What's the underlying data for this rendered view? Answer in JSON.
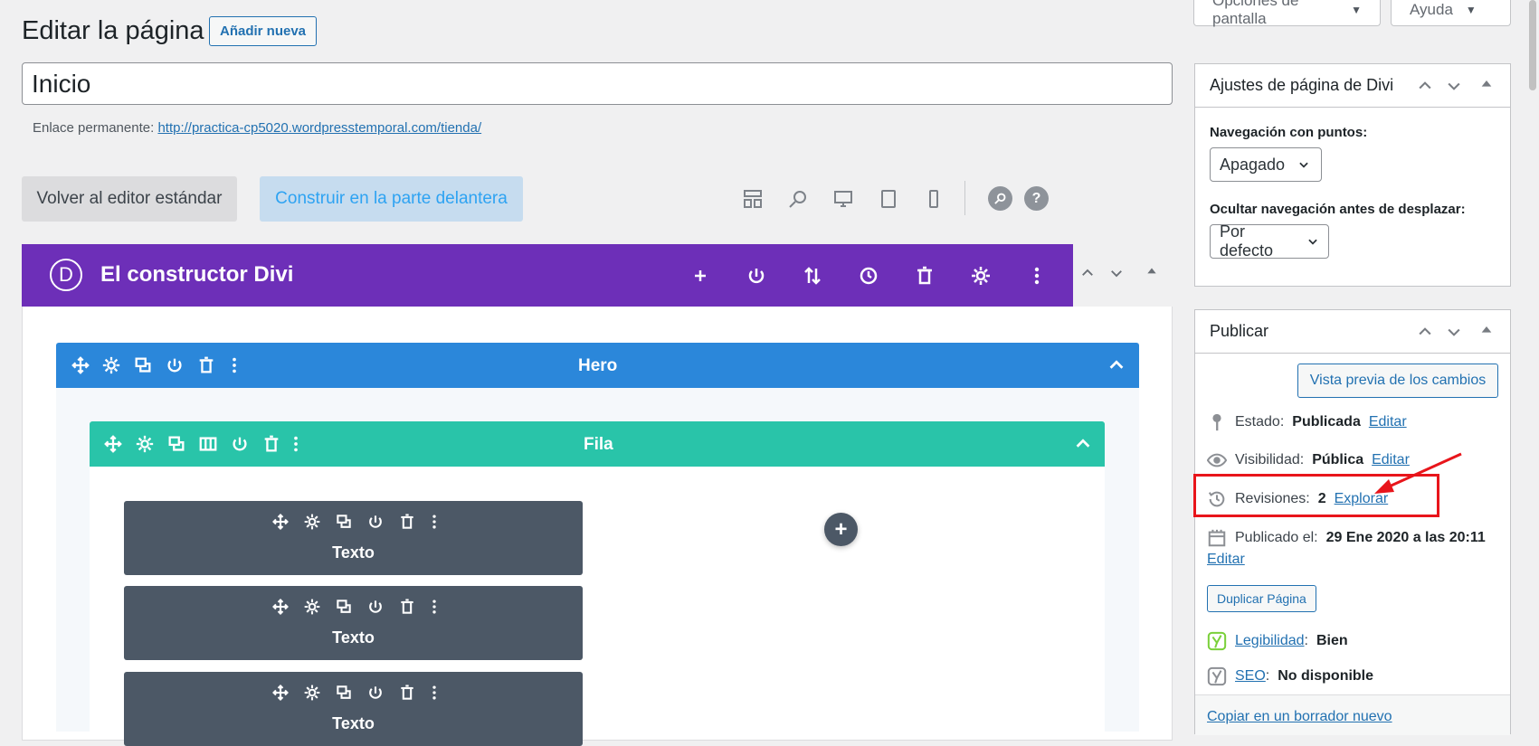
{
  "screen_options": {
    "label": "Opciones de pantalla",
    "caret": "▼"
  },
  "help": {
    "label": "Ayuda",
    "caret": "▼"
  },
  "page": {
    "title": "Editar la página",
    "add_new": "Añadir nueva",
    "post_title": "Inicio",
    "permalink_label": "Enlace permanente:",
    "permalink_url": "http://practica-cp5020.wordpresstemporal.com/tienda/"
  },
  "editor_buttons": {
    "standard": "Volver al editor estándar",
    "frontend": "Construir en la parte delantera"
  },
  "toolbar_icons": [
    "layout-icon",
    "zoom-icon",
    "desktop-icon",
    "tablet-icon",
    "phone-icon",
    "search-icon",
    "help-icon"
  ],
  "help_glyph": "?",
  "divi": {
    "logo": "D",
    "title": "El constructor Divi",
    "icons": [
      "add-icon",
      "power-icon",
      "sort-icon",
      "history-icon",
      "trash-icon",
      "settings-icon",
      "more-icon"
    ]
  },
  "section": {
    "title": "Hero"
  },
  "row": {
    "title": "Fila"
  },
  "modules": [
    {
      "title": "Texto"
    },
    {
      "title": "Texto"
    },
    {
      "title": "Texto"
    }
  ],
  "add_module_glyph": "+",
  "divi_settings": {
    "title": "Ajustes de página de Divi",
    "dot_nav_label": "Navegación con puntos:",
    "dot_nav_value": "Apagado",
    "hide_nav_label": "Ocultar navegación antes de desplazar:",
    "hide_nav_value": "Por defecto"
  },
  "publish": {
    "title": "Publicar",
    "preview": "Vista previa de los cambios",
    "status_label": "Estado:",
    "status_value": "Publicada",
    "visibility_label": "Visibilidad:",
    "visibility_value": "Pública",
    "edit": "Editar",
    "revisions_label": "Revisiones:",
    "revisions_value": "2",
    "revisions_link": "Explorar",
    "published_label": "Publicado el:",
    "published_value": "29 Ene 2020 a las 20:11",
    "duplicate": "Duplicar Página",
    "readability_label": "Legibilidad",
    "readability_value": "Bien",
    "seo_label": "SEO",
    "seo_value": "No disponible",
    "copy_draft": "Copiar en un borrador nuevo"
  },
  "colors": {
    "divi_purple": "#6d2fb8",
    "section_blue": "#2b87da",
    "row_teal": "#29c4a9",
    "module_gray": "#4c5866",
    "wp_link": "#2271b1",
    "annotation_red": "#e8151b"
  }
}
